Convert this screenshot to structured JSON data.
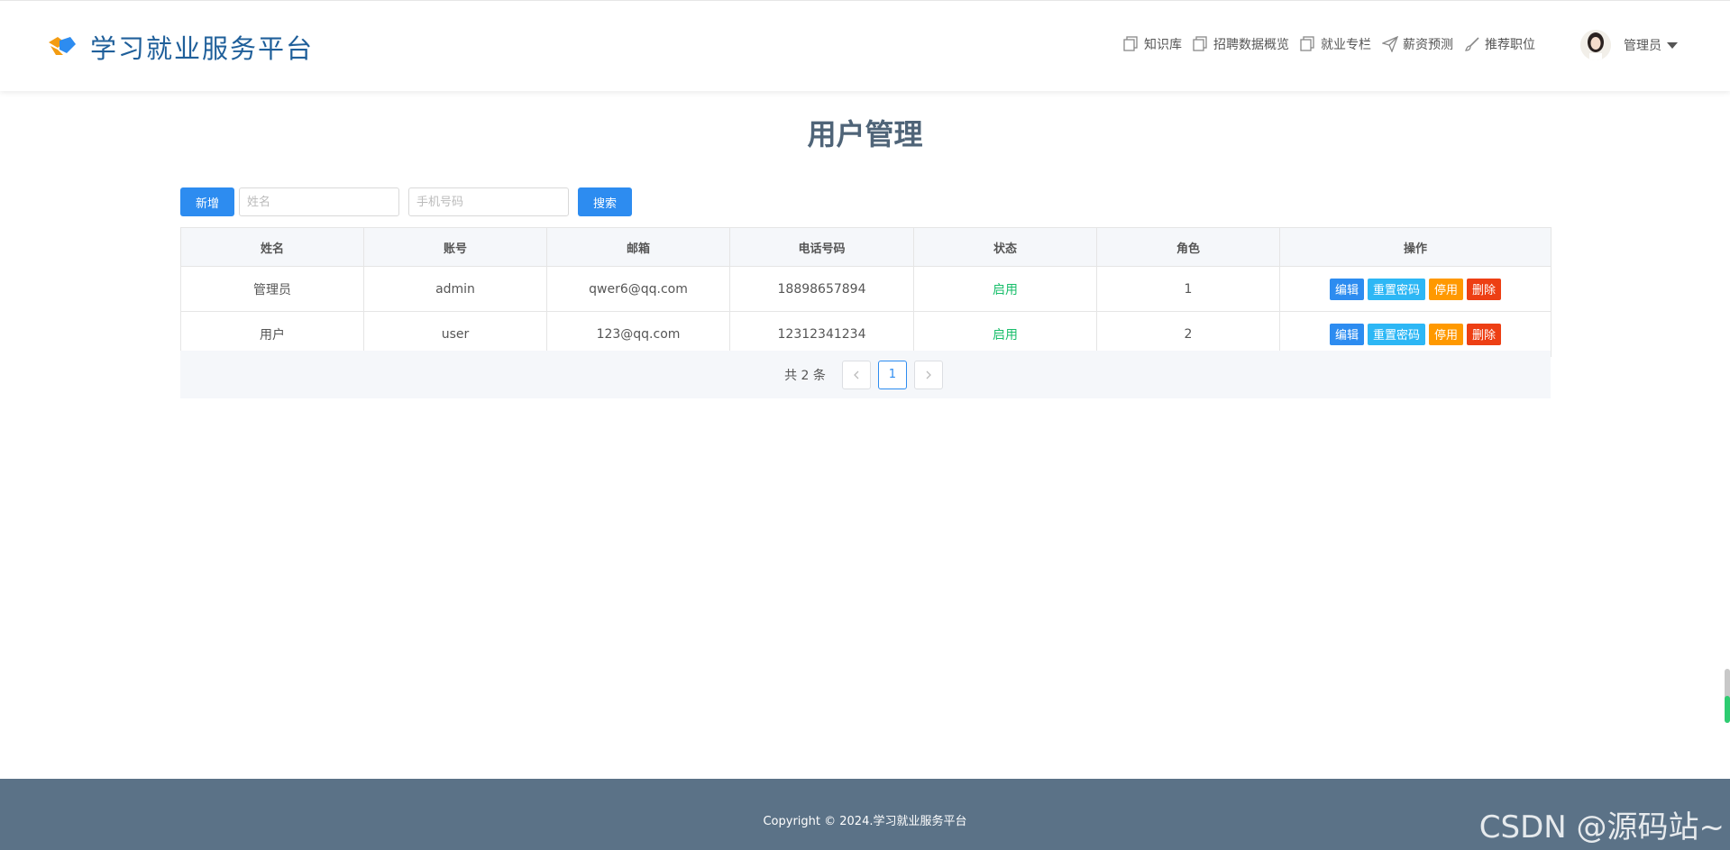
{
  "header": {
    "title": "学习就业服务平台",
    "nav": [
      {
        "label": "知识库",
        "icon": "copy-icon"
      },
      {
        "label": "招聘数据概览",
        "icon": "copy-icon"
      },
      {
        "label": "就业专栏",
        "icon": "copy-icon"
      },
      {
        "label": "薪资预测",
        "icon": "send-icon"
      },
      {
        "label": "推荐职位",
        "icon": "brush-icon"
      }
    ],
    "user": {
      "name": "管理员"
    }
  },
  "page": {
    "title": "用户管理",
    "add_label": "新增",
    "search_label": "搜索",
    "name_placeholder": "姓名",
    "phone_placeholder": "手机号码"
  },
  "table": {
    "columns": [
      "姓名",
      "账号",
      "邮箱",
      "电话号码",
      "状态",
      "角色",
      "操作"
    ],
    "rows": [
      {
        "name": "管理员",
        "account": "admin",
        "email": "qwer6@qq.com",
        "phone": "18898657894",
        "status": "启用",
        "role": "1"
      },
      {
        "name": "用户",
        "account": "user",
        "email": "123@qq.com",
        "phone": "12312341234",
        "status": "启用",
        "role": "2"
      }
    ],
    "actions": {
      "edit": "编辑",
      "reset": "重置密码",
      "disable": "停用",
      "delete": "删除"
    }
  },
  "pagination": {
    "total_text": "共 2 条",
    "current": "1"
  },
  "footer": {
    "copyright": "Copyright © 2024.学习就业服务平台",
    "watermark": "CSDN @源码站~"
  },
  "colors": {
    "primary": "#2d8cf0",
    "success": "#19be6b",
    "warning": "#ff9900",
    "danger": "#ed3f14",
    "footer": "#5b7287"
  }
}
